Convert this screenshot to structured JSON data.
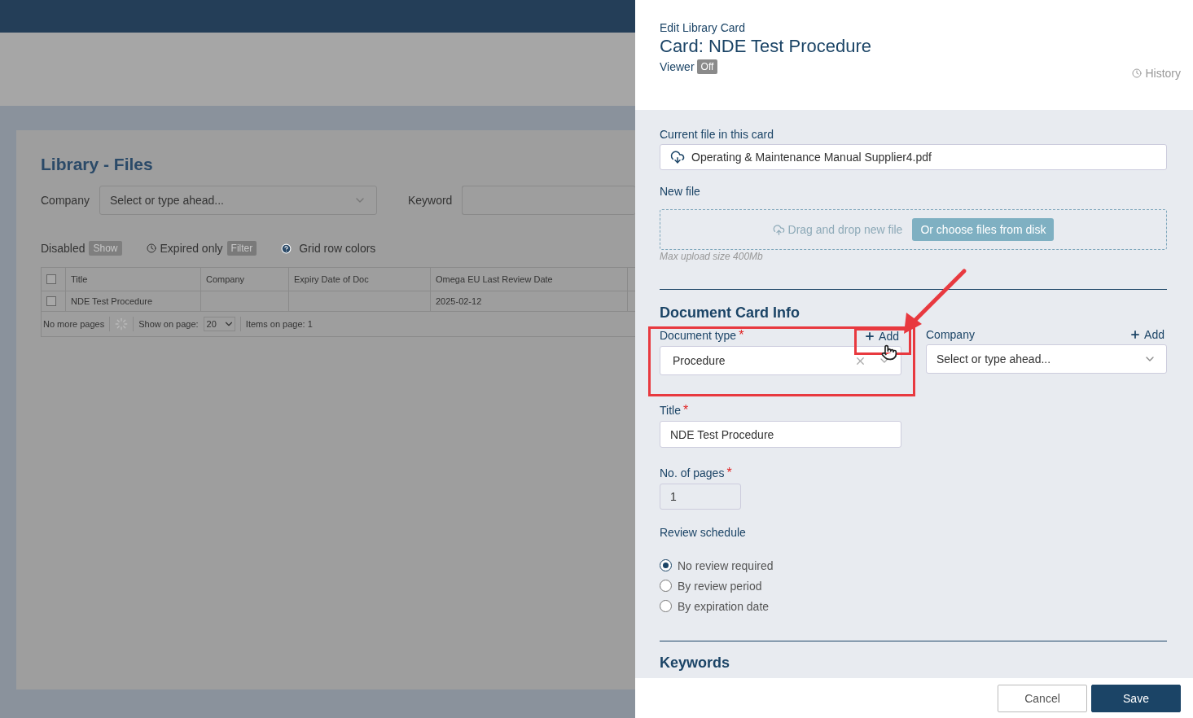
{
  "library": {
    "title": "Library - Files",
    "filters": {
      "company_label": "Company",
      "company_placeholder": "Select or type ahead...",
      "keyword_label": "Keyword"
    },
    "toggles": [
      {
        "kind": "badge",
        "label": "Disabled",
        "badge": "Show"
      },
      {
        "kind": "clock",
        "label": "Expired only",
        "badge": "Filter"
      },
      {
        "kind": "help",
        "label": "Grid row colors"
      }
    ],
    "table": {
      "header_checked": false,
      "columns": [
        "Title",
        "Company",
        "Expiry Date of Doc",
        "Omega EU Last Review Date"
      ],
      "rows": [
        {
          "checked": false,
          "cells": [
            "NDE Test Procedure",
            "",
            "",
            "2025-02-12"
          ]
        }
      ],
      "footer": {
        "pages": "No more pages",
        "show_label": "Show on page:",
        "page_size": "20",
        "items": "Items on page: 1"
      }
    }
  },
  "drawer": {
    "eyebrow": "Edit Library Card",
    "title": "Card: NDE Test Procedure",
    "viewer": {
      "label": "Viewer",
      "badge": "Off"
    },
    "history": "History",
    "current_file": {
      "label": "Current file in this card",
      "name": "Operating & Maintenance Manual Supplier4.pdf"
    },
    "new_file": {
      "label": "New file",
      "drop_text": "Drag and drop new file",
      "choose_button": "Or choose files from disk",
      "hint": "Max upload size 400Mb"
    },
    "section": "Document Card Info",
    "document_type": {
      "label": "Document type",
      "required_mark": "*",
      "add": "Add",
      "value": "Procedure"
    },
    "company": {
      "label": "Company",
      "add": "Add",
      "placeholder": "Select or type ahead..."
    },
    "title_field": {
      "label": "Title",
      "required_mark": "*",
      "value": "NDE Test Procedure"
    },
    "pages_field": {
      "label": "No. of pages",
      "required_mark": "*",
      "value": "1"
    },
    "review": {
      "label": "Review schedule",
      "options": [
        {
          "label": "No review required",
          "selected": true
        },
        {
          "label": "By review period",
          "selected": false
        },
        {
          "label": "By expiration date",
          "selected": false
        }
      ]
    },
    "keywords_heading": "Keywords",
    "buttons": {
      "cancel": "Cancel",
      "save": "Save"
    }
  }
}
